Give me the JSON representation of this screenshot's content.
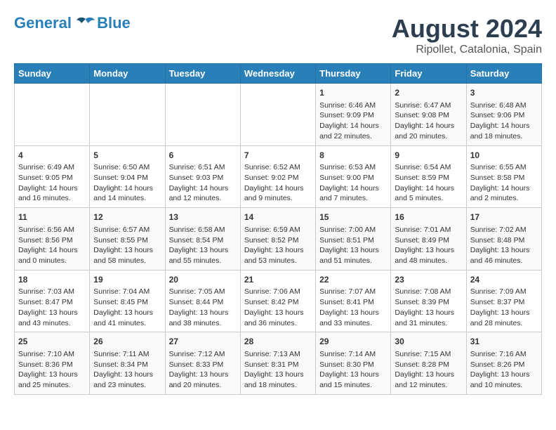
{
  "header": {
    "logo_line1": "General",
    "logo_line2": "Blue",
    "title": "August 2024",
    "subtitle": "Ripollet, Catalonia, Spain"
  },
  "days_of_week": [
    "Sunday",
    "Monday",
    "Tuesday",
    "Wednesday",
    "Thursday",
    "Friday",
    "Saturday"
  ],
  "weeks": [
    [
      {
        "day": "",
        "content": ""
      },
      {
        "day": "",
        "content": ""
      },
      {
        "day": "",
        "content": ""
      },
      {
        "day": "",
        "content": ""
      },
      {
        "day": "1",
        "content": "Sunrise: 6:46 AM\nSunset: 9:09 PM\nDaylight: 14 hours and 22 minutes."
      },
      {
        "day": "2",
        "content": "Sunrise: 6:47 AM\nSunset: 9:08 PM\nDaylight: 14 hours and 20 minutes."
      },
      {
        "day": "3",
        "content": "Sunrise: 6:48 AM\nSunset: 9:06 PM\nDaylight: 14 hours and 18 minutes."
      }
    ],
    [
      {
        "day": "4",
        "content": "Sunrise: 6:49 AM\nSunset: 9:05 PM\nDaylight: 14 hours and 16 minutes."
      },
      {
        "day": "5",
        "content": "Sunrise: 6:50 AM\nSunset: 9:04 PM\nDaylight: 14 hours and 14 minutes."
      },
      {
        "day": "6",
        "content": "Sunrise: 6:51 AM\nSunset: 9:03 PM\nDaylight: 14 hours and 12 minutes."
      },
      {
        "day": "7",
        "content": "Sunrise: 6:52 AM\nSunset: 9:02 PM\nDaylight: 14 hours and 9 minutes."
      },
      {
        "day": "8",
        "content": "Sunrise: 6:53 AM\nSunset: 9:00 PM\nDaylight: 14 hours and 7 minutes."
      },
      {
        "day": "9",
        "content": "Sunrise: 6:54 AM\nSunset: 8:59 PM\nDaylight: 14 hours and 5 minutes."
      },
      {
        "day": "10",
        "content": "Sunrise: 6:55 AM\nSunset: 8:58 PM\nDaylight: 14 hours and 2 minutes."
      }
    ],
    [
      {
        "day": "11",
        "content": "Sunrise: 6:56 AM\nSunset: 8:56 PM\nDaylight: 14 hours and 0 minutes."
      },
      {
        "day": "12",
        "content": "Sunrise: 6:57 AM\nSunset: 8:55 PM\nDaylight: 13 hours and 58 minutes."
      },
      {
        "day": "13",
        "content": "Sunrise: 6:58 AM\nSunset: 8:54 PM\nDaylight: 13 hours and 55 minutes."
      },
      {
        "day": "14",
        "content": "Sunrise: 6:59 AM\nSunset: 8:52 PM\nDaylight: 13 hours and 53 minutes."
      },
      {
        "day": "15",
        "content": "Sunrise: 7:00 AM\nSunset: 8:51 PM\nDaylight: 13 hours and 51 minutes."
      },
      {
        "day": "16",
        "content": "Sunrise: 7:01 AM\nSunset: 8:49 PM\nDaylight: 13 hours and 48 minutes."
      },
      {
        "day": "17",
        "content": "Sunrise: 7:02 AM\nSunset: 8:48 PM\nDaylight: 13 hours and 46 minutes."
      }
    ],
    [
      {
        "day": "18",
        "content": "Sunrise: 7:03 AM\nSunset: 8:47 PM\nDaylight: 13 hours and 43 minutes."
      },
      {
        "day": "19",
        "content": "Sunrise: 7:04 AM\nSunset: 8:45 PM\nDaylight: 13 hours and 41 minutes."
      },
      {
        "day": "20",
        "content": "Sunrise: 7:05 AM\nSunset: 8:44 PM\nDaylight: 13 hours and 38 minutes."
      },
      {
        "day": "21",
        "content": "Sunrise: 7:06 AM\nSunset: 8:42 PM\nDaylight: 13 hours and 36 minutes."
      },
      {
        "day": "22",
        "content": "Sunrise: 7:07 AM\nSunset: 8:41 PM\nDaylight: 13 hours and 33 minutes."
      },
      {
        "day": "23",
        "content": "Sunrise: 7:08 AM\nSunset: 8:39 PM\nDaylight: 13 hours and 31 minutes."
      },
      {
        "day": "24",
        "content": "Sunrise: 7:09 AM\nSunset: 8:37 PM\nDaylight: 13 hours and 28 minutes."
      }
    ],
    [
      {
        "day": "25",
        "content": "Sunrise: 7:10 AM\nSunset: 8:36 PM\nDaylight: 13 hours and 25 minutes."
      },
      {
        "day": "26",
        "content": "Sunrise: 7:11 AM\nSunset: 8:34 PM\nDaylight: 13 hours and 23 minutes."
      },
      {
        "day": "27",
        "content": "Sunrise: 7:12 AM\nSunset: 8:33 PM\nDaylight: 13 hours and 20 minutes."
      },
      {
        "day": "28",
        "content": "Sunrise: 7:13 AM\nSunset: 8:31 PM\nDaylight: 13 hours and 18 minutes."
      },
      {
        "day": "29",
        "content": "Sunrise: 7:14 AM\nSunset: 8:30 PM\nDaylight: 13 hours and 15 minutes."
      },
      {
        "day": "30",
        "content": "Sunrise: 7:15 AM\nSunset: 8:28 PM\nDaylight: 13 hours and 12 minutes."
      },
      {
        "day": "31",
        "content": "Sunrise: 7:16 AM\nSunset: 8:26 PM\nDaylight: 13 hours and 10 minutes."
      }
    ]
  ]
}
